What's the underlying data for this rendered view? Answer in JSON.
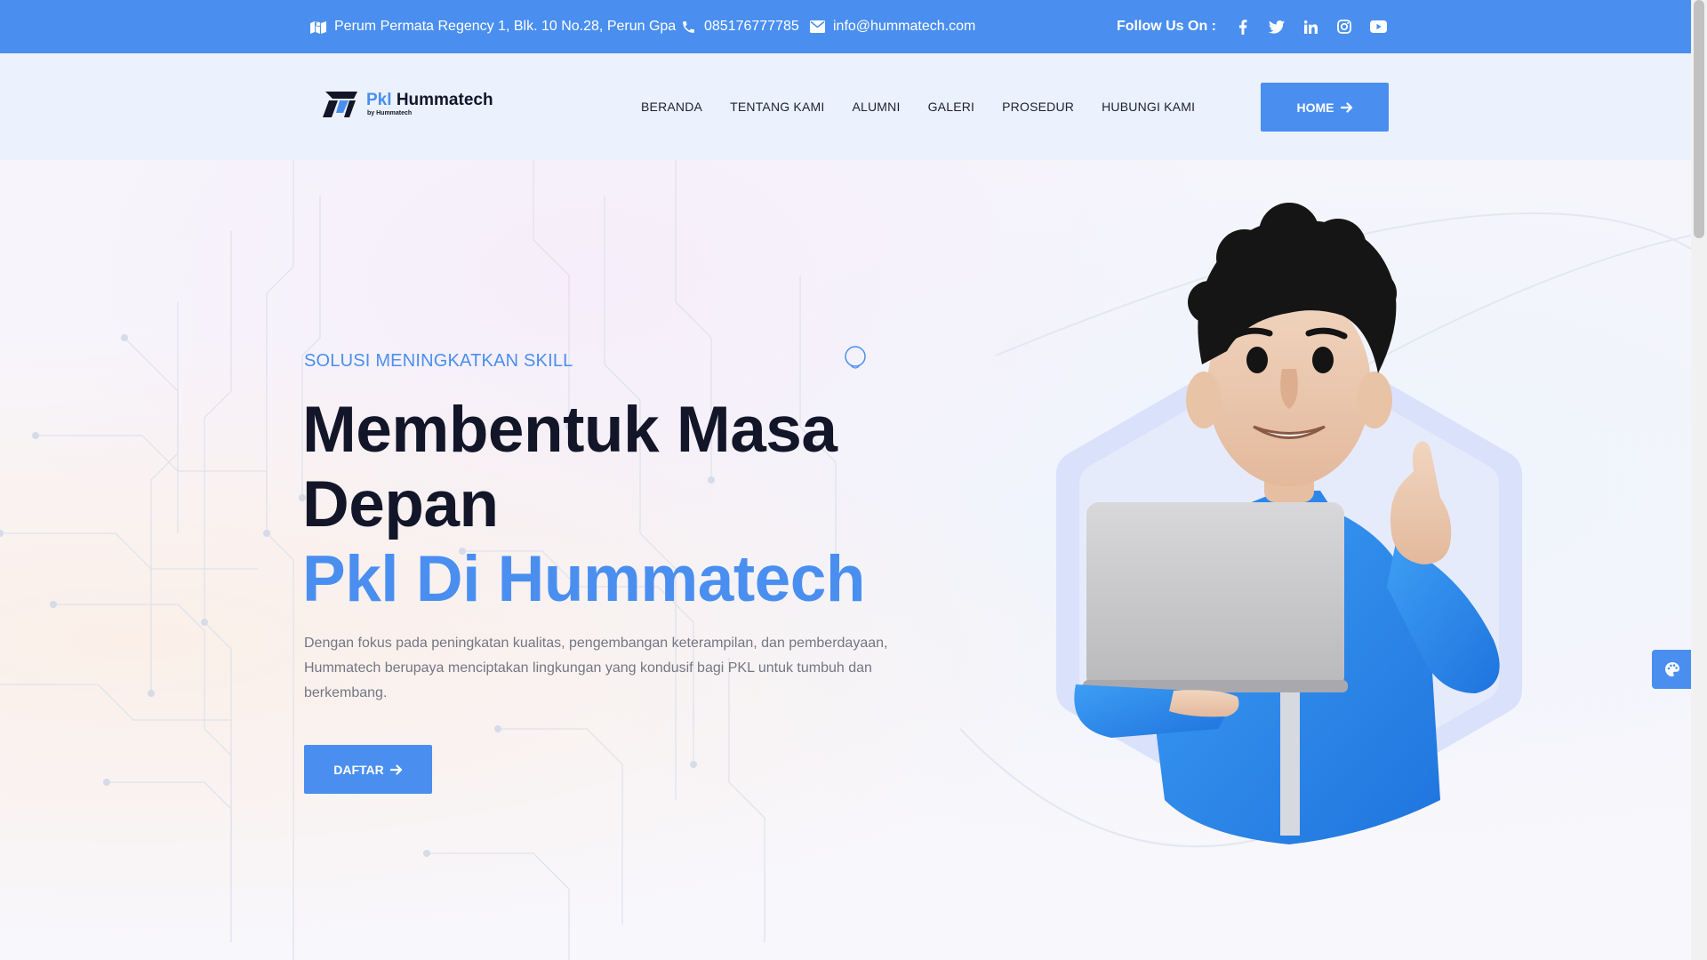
{
  "topbar": {
    "address": "Perum Permata Regency 1, Blk. 10 No.28, Perun Gpa",
    "phone": "085176777785",
    "email": "info@hummatech.com",
    "follow_label": "Follow Us On :",
    "social": [
      "facebook-icon",
      "twitter-icon",
      "linkedin-icon",
      "instagram-icon",
      "youtube-icon"
    ]
  },
  "logo": {
    "prefix": "Pkl",
    "name": "Hummatech",
    "byline": "by Hummatech"
  },
  "nav": {
    "items": [
      "BERANDA",
      "TENTANG KAMI",
      "ALUMNI",
      "GALERI",
      "PROSEDUR",
      "HUBUNGI KAMI"
    ]
  },
  "header": {
    "cta_label": "HOME"
  },
  "hero": {
    "tagline": "SOLUSI MENINGKATKAN SKILL",
    "title_line1": "Membentuk Masa",
    "title_line2": "Depan",
    "title_accent": "Pkl Di Hummatech",
    "description": "Dengan fokus pada peningkatan kualitas, pengembangan keterampilan, dan pemberdayaan, Hummatech berupaya menciptakan lingkungan yang kondusif bagi PKL untuk tumbuh dan berkembang.",
    "button_label": "DAFTAR"
  },
  "colors": {
    "accent": "#4a8ff0",
    "heading": "#121628",
    "body_text": "#747684",
    "header_bg": "#ebf2fd"
  }
}
